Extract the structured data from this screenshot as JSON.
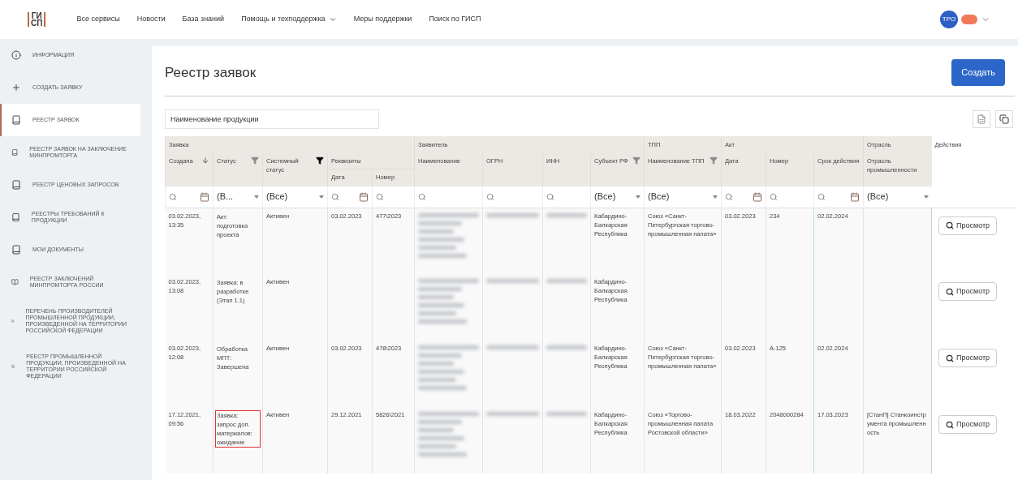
{
  "header": {
    "logo_top": "ГИ",
    "logo_bottom": "СП",
    "nav": [
      {
        "label": "Все сервисы",
        "dropdown": false
      },
      {
        "label": "Новости",
        "dropdown": false
      },
      {
        "label": "База знаний",
        "dropdown": false
      },
      {
        "label": "Помощь и техподдержка",
        "dropdown": true
      },
      {
        "label": "Меры поддержки",
        "dropdown": false
      },
      {
        "label": "Поиск по ГИСП",
        "dropdown": false
      }
    ],
    "avatar": "ТРО"
  },
  "sidebar": {
    "items": [
      {
        "label": "ИНФОРМАЦИЯ",
        "kind": "info",
        "selected": false
      },
      {
        "label": "СОЗДАТЬ ЗАЯВКУ",
        "kind": "plus",
        "selected": false
      },
      {
        "label": "РЕЕСТР ЗАЯВОК",
        "kind": "doc",
        "selected": true
      },
      {
        "label": "РЕЕСТР ЗАЯВОК НА ЗАКЛЮЧЕНИЕ МИНПРОМТОРГА",
        "kind": "doc",
        "selected": false
      },
      {
        "label": "РЕЕСТР ЦЕНОВЫХ ЗАПРОСОВ",
        "kind": "doc",
        "selected": false
      },
      {
        "label": "РЕЕСТРЫ ТРЕБОВАНИЙ К ПРОДУКЦИИ",
        "kind": "doc",
        "selected": false
      },
      {
        "label": "МОИ ДОКУМЕНТЫ",
        "kind": "doc",
        "selected": false
      },
      {
        "label": "РЕЕСТР ЗАКЛЮЧЕНИЙ МИНПРОМТОРГА РОССИИ",
        "kind": "book",
        "selected": false
      },
      {
        "label": "ПЕРЕЧЕНЬ ПРОИЗВОДИТЕЛЕЙ ПРОМЫШЛЕННОЙ ПРОДУКЦИИ, ПРОИЗВЕДЕННОЙ НА ТЕРРИТОРИИ РОССИЙСКОЙ ФЕДЕРАЦИИ",
        "kind": "book",
        "selected": false
      },
      {
        "label": "РЕЕСТР ПРОМЫШЛЕННОЙ ПРОДУКЦИИ, ПРОИЗВЕДЕННОЙ НА ТЕРРИТОРИИ РОССИЙСКОЙ ФЕДЕРАЦИИ",
        "kind": "book",
        "selected": false
      }
    ]
  },
  "page": {
    "title": "Реестр заявок",
    "create_button": "Создать",
    "search": {
      "placeholder": "Наименование продукции"
    }
  },
  "table": {
    "groups": [
      "Заявка",
      "Заявитель",
      "ТПП",
      "Акт",
      "Отрасль"
    ],
    "actions_header": "Действия",
    "requisites_header": "Реквизиты",
    "columns": [
      {
        "label": "Создана",
        "sorted": true
      },
      {
        "label": "Статус",
        "filterable": true,
        "filter_active": false
      },
      {
        "label": "Системный статус",
        "filterable": true,
        "filter_active": true
      },
      {
        "label": "Дата"
      },
      {
        "label": "Номер"
      },
      {
        "label": "Наименование"
      },
      {
        "label": "ОГРН"
      },
      {
        "label": "ИНН"
      },
      {
        "label": "Субъект РФ",
        "filterable": true,
        "filter_active": false
      },
      {
        "label": "Наименование ТПП",
        "filterable": true,
        "filter_active": false
      },
      {
        "label": "Дата"
      },
      {
        "label": "Номер"
      },
      {
        "label": "Срок действия"
      },
      {
        "label": "Отрасль промышленности"
      }
    ],
    "filters": [
      {
        "kind": "date"
      },
      {
        "kind": "select",
        "value": "(В..."
      },
      {
        "kind": "select",
        "value": "(Все)"
      },
      {
        "kind": "date"
      },
      {
        "kind": "search"
      },
      {
        "kind": "search"
      },
      {
        "kind": "search"
      },
      {
        "kind": "search"
      },
      {
        "kind": "select",
        "value": "(Все)"
      },
      {
        "kind": "select",
        "value": "(Все)"
      },
      {
        "kind": "date"
      },
      {
        "kind": "search"
      },
      {
        "kind": "date"
      },
      {
        "kind": "select",
        "value": "(Все)"
      }
    ],
    "rows": [
      {
        "created": "03.02.2023, 13:35",
        "status": "Акт: подготовка проекта",
        "highlighted": false,
        "system_status": "Активен",
        "req_date": "03.02.2023",
        "req_number": "477\\2023",
        "subject": "Кабардино-Балкарская Республика",
        "tpp": "Союз «Санкт-Петербургская торгово-промышленная палата»",
        "act_date": "03.02.2023",
        "act_number": "234",
        "validity": "02.02.2024",
        "action": "Просмотр"
      },
      {
        "created": "03.02.2023, 13:08",
        "status": "Заявка: в разработке (Этап 1.1)",
        "highlighted": false,
        "system_status": "Активен",
        "subject": "Кабардино-Балкарская Республика",
        "action": "Просмотр"
      },
      {
        "created": "03.02.2023, 12:08",
        "status": "Обработка МПТ: Завершена",
        "highlighted": false,
        "system_status": "Активен",
        "req_date": "03.02.2023",
        "req_number": "478\\2023",
        "subject": "Кабардино-Балкарская Республика",
        "tpp": "Союз «Санкт-Петербургская торгово-промышленная палата»",
        "act_date": "03.02.2023",
        "act_number": "А-125",
        "validity": "02.02.2024",
        "action": "Просмотр"
      },
      {
        "created": "17.12.2021, 09:56",
        "status": "Заявка: запрос доп. материалов: ожидание",
        "highlighted": true,
        "system_status": "Активен",
        "req_date": "29.12.2021",
        "req_number": "5826\\2021",
        "subject": "Кабардино-Балкарская Республика",
        "tpp": "Союз «Торгово-промышленная палата Ростовской области»",
        "act_date": "18.03.2022",
        "act_number": "2048000284",
        "validity": "17.03.2023",
        "industry": "[СтанП] Станкоинструмента промышленность",
        "action": "Просмотр"
      }
    ]
  }
}
